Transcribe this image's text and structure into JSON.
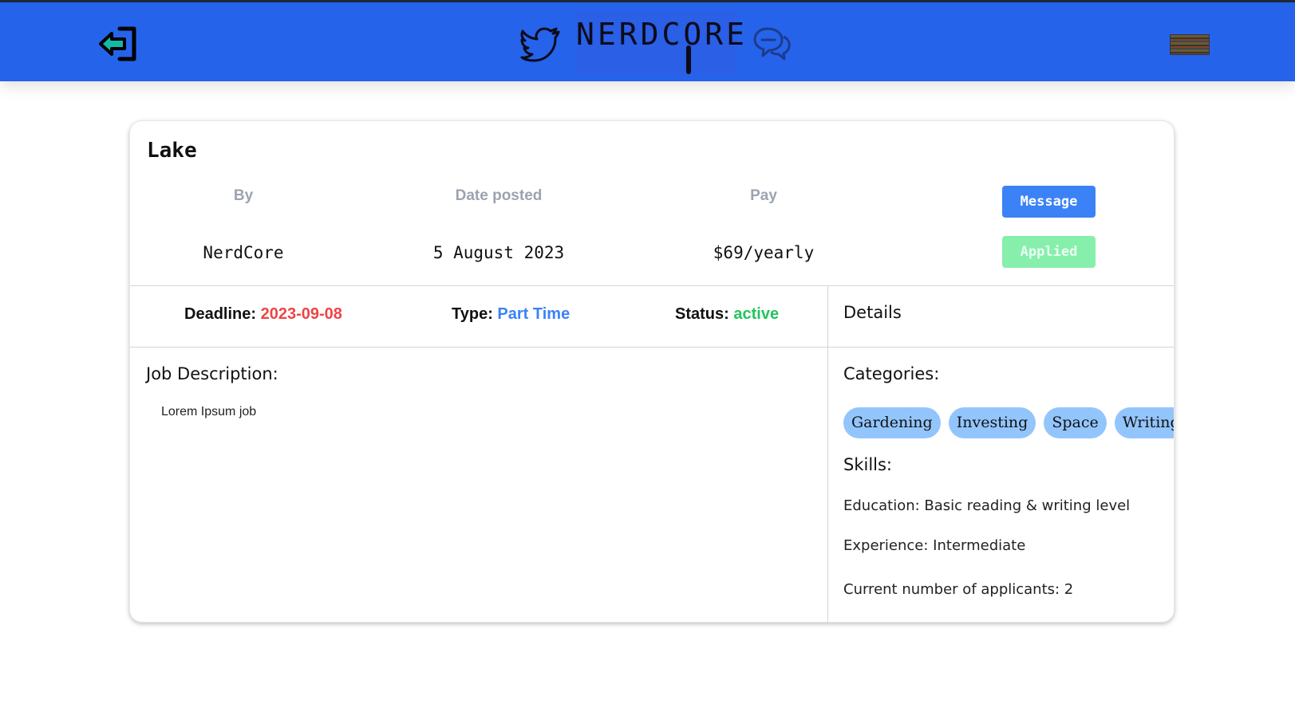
{
  "header": {
    "logo_text": "NERDCORE",
    "icons": {
      "logout": "logout-icon",
      "twitter": "twitter-icon",
      "chat": "chat-icon",
      "avatar": "avatar"
    },
    "bg_color": "#2563eb"
  },
  "job": {
    "title": "Lake",
    "labels": {
      "by": "By",
      "date": "Date posted",
      "pay": "Pay"
    },
    "by": "NerdCore",
    "date_posted": "5 August 2023",
    "pay": "$69/yearly",
    "buttons": {
      "message": "Message",
      "applied": "Applied"
    },
    "deadline_label": "Deadline:",
    "deadline": "2023-09-08",
    "type_label": "Type:",
    "type": "Part Time",
    "status_label": "Status:",
    "status": "active",
    "details_title": "Details",
    "description_title": "Job Description:",
    "description": "Lorem Ipsum job",
    "categories_title": "Categories:",
    "categories": [
      "Gardening",
      "Investing",
      "Space",
      "Writing"
    ],
    "skills_title": "Skills:",
    "education": "Education: Basic reading & writing level",
    "experience": "Experience: Intermediate",
    "applicants": "Current number of applicants: 2"
  },
  "colors": {
    "message_button": "#3b82f6",
    "applied_button": "#86efac",
    "deadline": "#ef4444",
    "type": "#3b82f6",
    "status": "#22c55e",
    "chip": "#93c5fd"
  }
}
